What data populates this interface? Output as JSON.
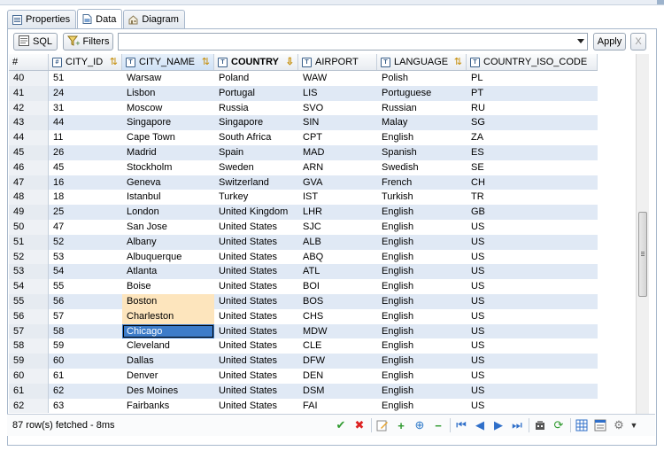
{
  "tabs": [
    {
      "label": "Properties",
      "icon": "properties-icon"
    },
    {
      "label": "Data",
      "icon": "data-icon"
    },
    {
      "label": "Diagram",
      "icon": "diagram-icon"
    }
  ],
  "toolbar": {
    "sql_label": "SQL",
    "filters_label": "Filters",
    "filter_value": "",
    "apply_label": "Apply",
    "clear_label": "X"
  },
  "grid": {
    "columns": [
      {
        "label": "#"
      },
      {
        "label": "CITY_ID"
      },
      {
        "label": "CITY_NAME"
      },
      {
        "label": "COUNTRY"
      },
      {
        "label": "AIRPORT"
      },
      {
        "label": "LANGUAGE"
      },
      {
        "label": "COUNTRY_ISO_CODE"
      }
    ],
    "rows": [
      [
        "40",
        "51",
        "Warsaw",
        "Poland",
        "WAW",
        "Polish",
        "PL"
      ],
      [
        "41",
        "24",
        "Lisbon",
        "Portugal",
        "LIS",
        "Portuguese",
        "PT"
      ],
      [
        "42",
        "31",
        "Moscow",
        "Russia",
        "SVO",
        "Russian",
        "RU"
      ],
      [
        "43",
        "44",
        "Singapore",
        "Singapore",
        "SIN",
        "Malay",
        "SG"
      ],
      [
        "44",
        "11",
        "Cape Town",
        "South Africa",
        "CPT",
        "English",
        "ZA"
      ],
      [
        "45",
        "26",
        "Madrid",
        "Spain",
        "MAD",
        "Spanish",
        "ES"
      ],
      [
        "46",
        "45",
        "Stockholm",
        "Sweden",
        "ARN",
        "Swedish",
        "SE"
      ],
      [
        "47",
        "16",
        "Geneva",
        "Switzerland",
        "GVA",
        "French",
        "CH"
      ],
      [
        "48",
        "18",
        "Istanbul",
        "Turkey",
        "IST",
        "Turkish",
        "TR"
      ],
      [
        "49",
        "25",
        "London",
        "United Kingdom",
        "LHR",
        "English",
        "GB"
      ],
      [
        "50",
        "47",
        "San Jose",
        "United States",
        "SJC",
        "English",
        "US"
      ],
      [
        "51",
        "52",
        "Albany",
        "United States",
        "ALB",
        "English",
        "US"
      ],
      [
        "52",
        "53",
        "Albuquerque",
        "United States",
        "ABQ",
        "English",
        "US"
      ],
      [
        "53",
        "54",
        "Atlanta",
        "United States",
        "ATL",
        "English",
        "US"
      ],
      [
        "54",
        "55",
        "Boise",
        "United States",
        "BOI",
        "English",
        "US"
      ],
      [
        "55",
        "56",
        "Boston",
        "United States",
        "BOS",
        "English",
        "US"
      ],
      [
        "56",
        "57",
        "Charleston",
        "United States",
        "CHS",
        "English",
        "US"
      ],
      [
        "57",
        "58",
        "Chicago",
        "United States",
        "MDW",
        "English",
        "US"
      ],
      [
        "58",
        "59",
        "Cleveland",
        "United States",
        "CLE",
        "English",
        "US"
      ],
      [
        "59",
        "60",
        "Dallas",
        "United States",
        "DFW",
        "English",
        "US"
      ],
      [
        "60",
        "61",
        "Denver",
        "United States",
        "DEN",
        "English",
        "US"
      ],
      [
        "61",
        "62",
        "Des Moines",
        "United States",
        "DSM",
        "English",
        "US"
      ],
      [
        "62",
        "63",
        "Fairbanks",
        "United States",
        "FAI",
        "English",
        "US"
      ]
    ]
  },
  "status": {
    "text": "87 row(s) fetched - 8ms"
  },
  "colors": {
    "alt_row": "#e0e9f5",
    "highlight": "#fde5bd",
    "focus": "#3d7cc9"
  }
}
